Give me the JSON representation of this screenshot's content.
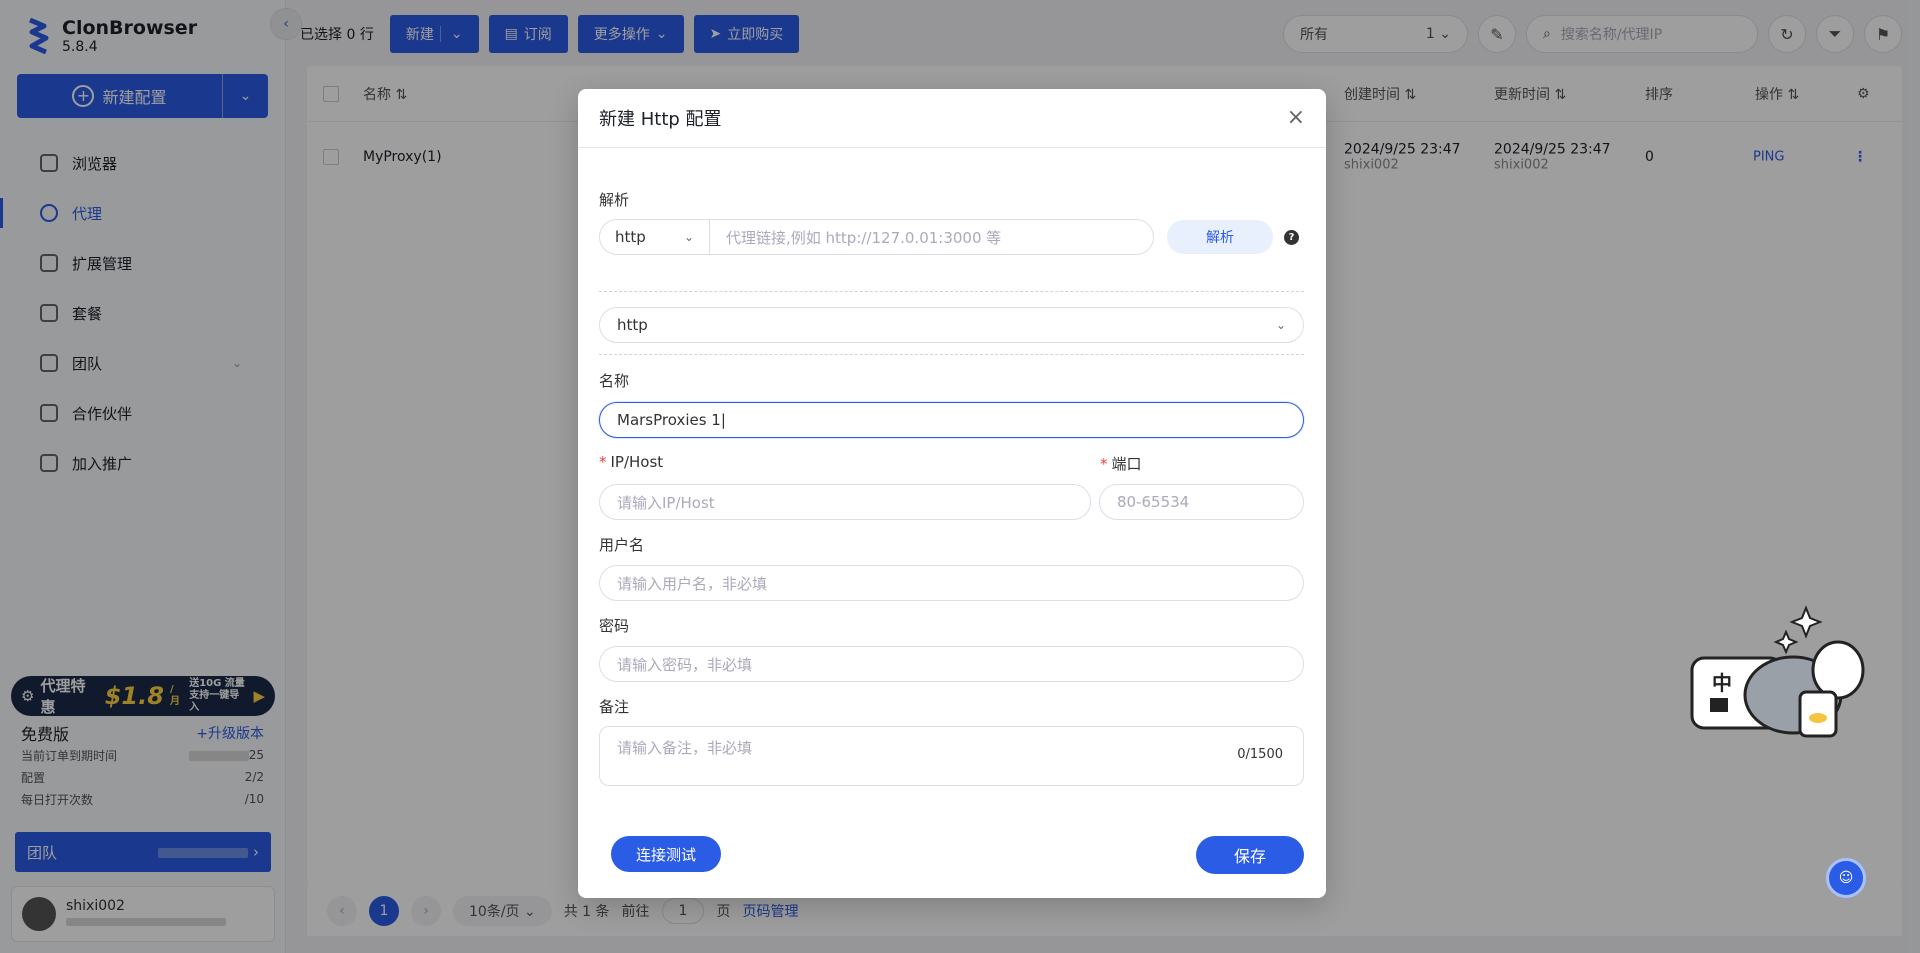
{
  "app": {
    "name": "ClonBrowser",
    "version": "5.8.4"
  },
  "sidebar": {
    "new_config_label": "新建配置",
    "items": [
      {
        "label": "浏览器"
      },
      {
        "label": "代理"
      },
      {
        "label": "扩展管理"
      },
      {
        "label": "套餐"
      },
      {
        "label": "团队"
      },
      {
        "label": "合作伙伴"
      },
      {
        "label": "加入推广"
      }
    ],
    "promo": {
      "text": "代理特惠",
      "price": "$1.8",
      "unit": "/月",
      "line1": "送10G 流量",
      "line2": "支持一键导入"
    },
    "plan": {
      "title": "免费版",
      "upgrade": "+升级版本",
      "rows": [
        {
          "label": "当前订单到期时间",
          "value": "25"
        },
        {
          "label": "配置",
          "value": "2/2"
        },
        {
          "label": "每日打开次数",
          "value": "/10"
        }
      ]
    },
    "team_label": "团队",
    "user": {
      "name": "shixi002"
    }
  },
  "toolbar": {
    "selected_prefix": "已选择",
    "selected_count": "0",
    "selected_suffix": "行",
    "new_label": "新建",
    "order_label": "订阅",
    "more_label": "更多操作",
    "buy_label": "立即购买",
    "filter_label": "所有",
    "filter_count": "1",
    "search_placeholder": "搜索名称/代理IP"
  },
  "table": {
    "headers": {
      "name": "名称",
      "created": "创建时间",
      "updated": "更新时间",
      "order": "排序",
      "action": "操作"
    },
    "rows": [
      {
        "name": "MyProxy(1)",
        "created": "2024/9/25 23:47",
        "created_by": "shixi002",
        "updated": "2024/9/25 23:47",
        "updated_by": "shixi002",
        "order": "0",
        "action": "PING"
      }
    ]
  },
  "pager": {
    "page": "1",
    "page_size": "10条/页",
    "total": "共 1 条",
    "goto_prefix": "前往",
    "goto_value": "1",
    "goto_suffix": "页",
    "manage": "页码管理"
  },
  "modal": {
    "title": "新建 Http 配置",
    "parse_label": "解析",
    "protocol": "http",
    "link_placeholder": "代理链接,例如 http://127.0.01:3000 等",
    "parse_button": "解析",
    "type_value": "http",
    "name_label": "名称",
    "name_value": "MarsProxies 1",
    "host_label": "IP/Host",
    "host_placeholder": "请输入IP/Host",
    "port_label": "端口",
    "port_placeholder": "80-65534",
    "username_label": "用户名",
    "username_placeholder": "请输入用户名，非必填",
    "password_label": "密码",
    "password_placeholder": "请输入密码，非必填",
    "remark_label": "备注",
    "remark_placeholder": "请输入备注，非必填",
    "remark_counter": "0/1500",
    "test_button": "连接测试",
    "save_button": "保存"
  },
  "mascot": {
    "badge": "中"
  },
  "colors": {
    "accent": "#2b5ce6",
    "required": "#f53f3f"
  }
}
